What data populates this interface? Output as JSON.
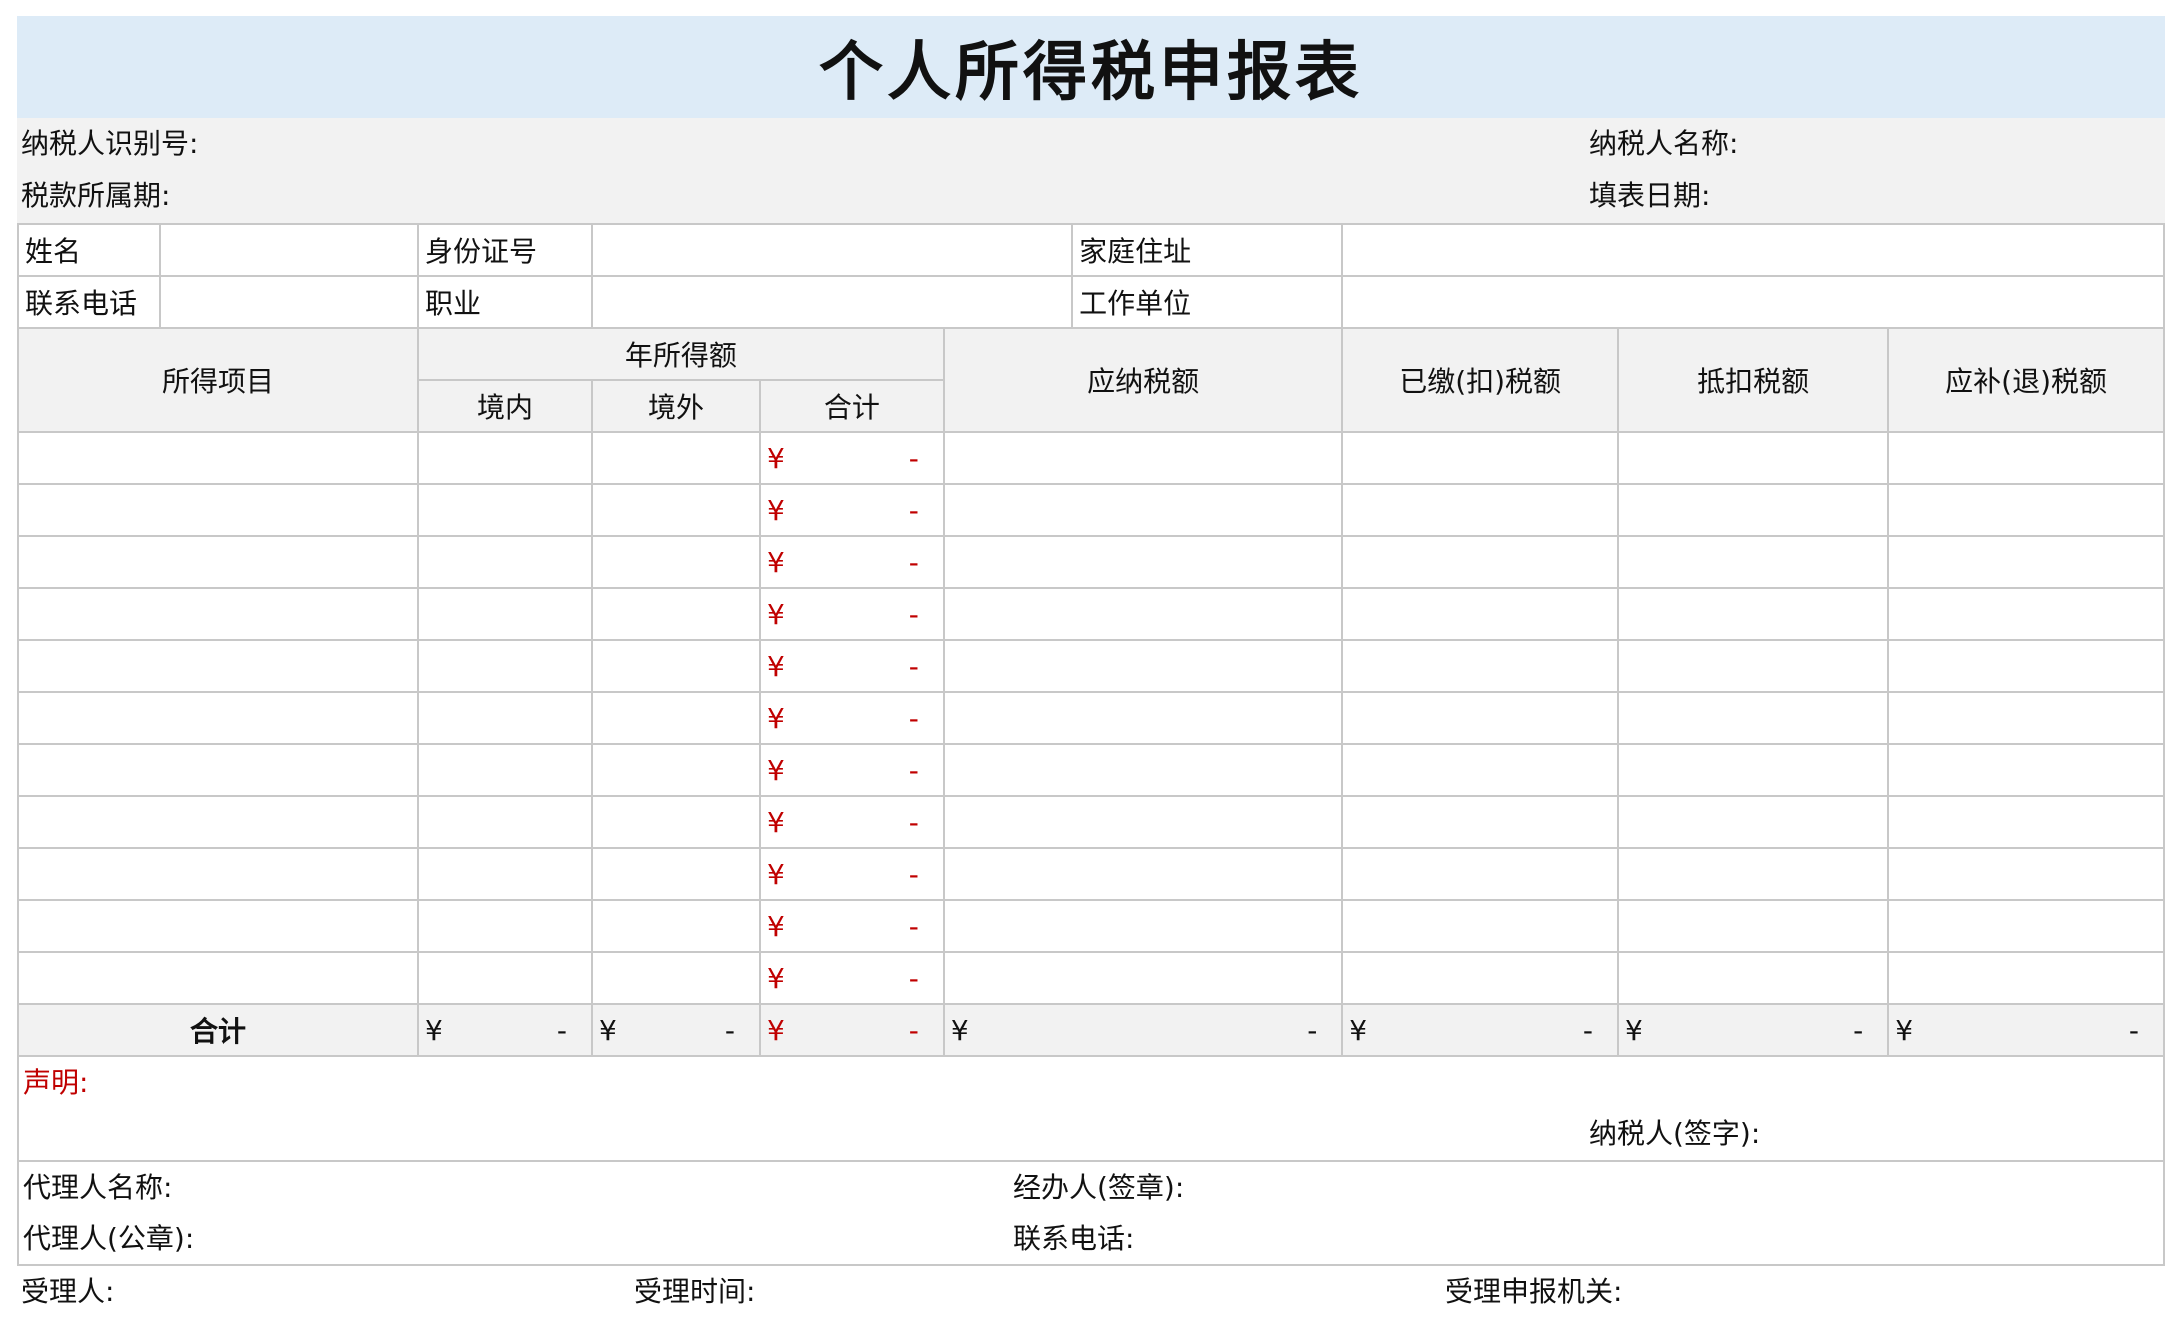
{
  "title": "个人所得税申报表",
  "header": {
    "taxpayer_id_label": "纳税人识别号:",
    "taxpayer_name_label": "纳税人名称:",
    "tax_period_label": "税款所属期:",
    "fill_date_label": "填表日期:"
  },
  "info": {
    "name_label": "姓名",
    "id_card_label": "身份证号",
    "address_label": "家庭住址",
    "phone_label": "联系电话",
    "job_label": "职业",
    "employer_label": "工作单位"
  },
  "table": {
    "col_income_item": "所得项目",
    "col_annual_income": "年所得额",
    "col_domestic": "境内",
    "col_overseas": "境外",
    "col_subtotal": "合计",
    "col_tax_payable": "应纳税额",
    "col_tax_paid": "已缴(扣)税额",
    "col_tax_credit": "抵扣税额",
    "col_tax_due": "应补(退)税额",
    "currency": "¥",
    "dash": "-",
    "total_label": "合计"
  },
  "declaration": {
    "label": "声明:",
    "signature_label": "纳税人(签字):"
  },
  "agent": {
    "name_label": "代理人名称:",
    "handler_label": "经办人(签章):",
    "seal_label": "代理人(公章):",
    "phone_label": "联系电话:"
  },
  "footer": {
    "receiver_label": "受理人:",
    "receive_time_label": "受理时间:",
    "authority_label": "受理申报机关:"
  }
}
